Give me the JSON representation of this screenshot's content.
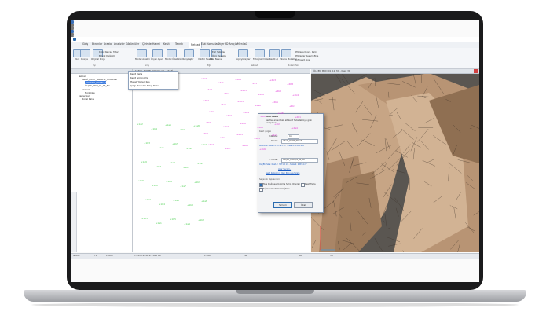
{
  "ribbon": {
    "tabs": [
      "Giriş",
      "Ekranlar",
      "Arazia",
      "Analizler",
      "Görüntüler",
      "Çizimler",
      "Hacmi",
      "Kesit",
      "Teknik",
      "Netcad",
      "Eski Komutları",
      "Ölçer",
      "3D Araçlar",
      "Menüsü"
    ],
    "active_tab": "Netcad",
    "big_buttons": [
      {
        "label": "Yeni"
      },
      {
        "label": "Dosya"
      },
      {
        "label": "Orijinal Proje"
      },
      {
        "label": "Model Analizi"
      },
      {
        "label": "Ölçek Ayarı"
      },
      {
        "label": "Model Özellikleri"
      },
      {
        "label": "Karşılaştır"
      },
      {
        "label": "Vektör Hesabı"
      },
      {
        "label": "Ekle Nesne"
      },
      {
        "label": "Açıkyüzeyler"
      },
      {
        "label": "Fotoğraf Düzelt"
      },
      {
        "label": "Kesiti Al"
      },
      {
        "label": "Ekstra Modeller"
      }
    ],
    "small_buttons": [
      "Kroki Netcad Tutar",
      "Büyük Değişim",
      "Eğri Tabloları",
      "Ölçü Hesapla",
      "PhPlana Koord. Kırık",
      "PhPlanlar Reserit.Ekle",
      "Diff kesit ölçe"
    ],
    "groups": [
      "Eşi",
      "Giriş",
      "Eğri",
      "Netcad",
      "Modeli Eski"
    ]
  },
  "dropdown": {
    "items": [
      "Kesit Fazla",
      "Kesit Görünümü",
      "Hatalı Yüzleri Kes",
      "Çizgi Modelini Kalıp Dizin"
    ]
  },
  "tree": {
    "items": [
      "Netcad",
      "ARAZİ_MUHT_KIBALIYE_STOKLASI",
      "_SOLIDER_MODEL_1",
      "ÖLÇEK_MOD_01_12_3D",
      "Kamera",
      "Modelizle",
      "Kameralar",
      "Model Kalıbı"
    ]
  },
  "cad_view": {
    "title": "SANAL_MODEL_KOŞULLAR - ARAZİ",
    "pink_labels": [
      "+2b4",
      "+2a1",
      "+2b6",
      "+25",
      "+2b3",
      "+2b8",
      "+2a3",
      "+2b1",
      "+2b3",
      "+2a9",
      "+2b0",
      "+2b4",
      "+2b2",
      "+2a6",
      "+2b5",
      "+2a0",
      "+2b1",
      "+2b7",
      "+2b3",
      "+2a2",
      "+2b4",
      "+2b0",
      "+2a5",
      "+2b1",
      "+2b6",
      "+2b2",
      "+2a8",
      "+2b3",
      "+2b9",
      "+2a4",
      "+2b0",
      "+2b7",
      "+2b1",
      "+2b5",
      "+2a3",
      "+2b2",
      "+2b4",
      "+2a7",
      "+2b0",
      "+2b6"
    ],
    "green_labels": [
      "+1a2",
      "+1b4",
      "+1a6",
      "+1b0",
      "+1a8",
      "+1b3",
      "+1a1",
      "+1b5",
      "+1a4",
      "+1b2",
      "+1a9",
      "+1b7",
      "+1a3",
      "+1b1",
      "+1a5",
      "+1b6",
      "+1a0",
      "+1b8",
      "+1a7",
      "+1b9",
      "+1a2",
      "+1b4",
      "+1a6",
      "+1b0",
      "+1a8",
      "+1b3",
      "+1a1",
      "+1b5",
      "+1a4",
      "+1b2"
    ]
  },
  "view_3d": {
    "title": "ÖLÇEK_MOD_01_12_3D - Kesit 3D"
  },
  "dialog": {
    "title": "Kesit Fazla",
    "description": "Kesitler arasındaki alt kesit fazla tabloyu girin hesaplanır.",
    "section_header": "Kesit çizgisi",
    "tolerance_label": "Tolerans:",
    "tolerance_value": "0.1",
    "model1_label": "1. Model:",
    "model1_value": "ARAZİ_MUHT_TABAN",
    "model1_info": "Alt Model - Kesit-1: 2756.3 m² - Fazla-1: 2581.2 m³",
    "model2_label": "2. Model:",
    "model2_value": "ÖLÇEK_MOD_01_12_3D",
    "model2_info": "ÖLÇEK Fazla: Kesit-2: 3271.2 m² - Fazla-2: 2953.4 m³",
    "link1": "Ayar Seçimi...",
    "link2": "Kesit Kalıplarını Yeni Pano'ya Sırala",
    "options_header": "Seçenek Yapılandırır",
    "option1": "Ters Doğrusal Kırılıma Sahip Olanları",
    "option2": "Kesit Fazla",
    "option3": "Sığmaz Kestirme Dağıtma",
    "ok_label": "Tamam",
    "cancel_label": "İptal"
  },
  "status": {
    "items": [
      "IKOOR",
      "70",
      "11000",
      "X:-411 Y:2016 Z:1.000 OK",
      "1:500",
      "100",
      "Kot",
      "3D"
    ]
  },
  "colors": {
    "accent": "#2b6cb0",
    "pink": "#e23bd8",
    "green": "#56d25a",
    "mesh": "#c9a78a"
  }
}
